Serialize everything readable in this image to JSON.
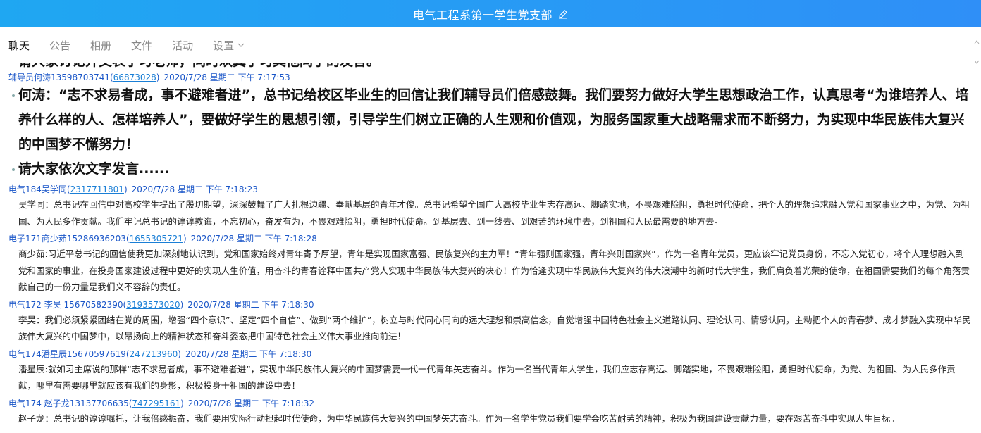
{
  "window": {
    "title": "电气工程系第一学生党支部"
  },
  "tabs": [
    {
      "label": "聊天"
    },
    {
      "label": "公告"
    },
    {
      "label": "相册"
    },
    {
      "label": "文件"
    },
    {
      "label": "活动"
    },
    {
      "label": "设置"
    }
  ],
  "chat": {
    "partial_top": "请大家讨论并交表了习老师，同时欢翼学习其他同学的发言。",
    "messages": [
      {
        "sender": "辅导员何涛13598703741",
        "qq": "66873028",
        "time": "2020/7/28 星期二 下午 7:17:53",
        "lines": [
          "何涛：“志不求易者成，事不避难者进”，总书记给校区毕业生的回信让我们辅导员们倍感鼓舞。我们要努力做好大学生思想政治工作，认真思考“为谁培养人、培养什么样的人、怎样培养人”，要做好学生的思想引领，引导学生们树立正确的人生观和价值观，为服务国家重大战略需求而不断努力，为实现中华民族伟大复兴的中国梦不懈努力！",
          "请大家依次文字发言......"
        ]
      },
      {
        "sender": "电气184吴学同",
        "qq": "2317711801",
        "time": "2020/7/28 星期二 下午 7:18:23",
        "text": "吴学同：总书记在回信中对高校学生提出了殷切期望，深深鼓舞了广大扎根边疆、奉献基层的青年才俊。总书记希望全国广大高校毕业生志存高远、脚踏实地，不畏艰难险阻，勇担时代使命，把个人的理想追求融入党和国家事业之中，为党、为祖国、为人民多作贡献。我们牢记总书记的谆谆教诲，不忘初心，奋发有为，不畏艰难险阻，勇担时代使命。到基层去、到一线去、到艰苦的环境中去，到祖国和人民最需要的地方去。"
      },
      {
        "sender": "电子171商少茹15286936203",
        "qq": "1655305721",
        "time": "2020/7/28 星期二 下午 7:18:28",
        "text": "商少茹:习近平总书记的回信使我更加深刻地认识到，党和国家始终对青年寄予厚望，青年是实现国家富强、民族复兴的主力军！“青年强则国家强，青年兴则国家兴”，作为一名青年党员，更应该牢记党员身份，不忘入党初心，将个人理想融入到党和国家的事业，在投身国家建设过程中更好的实现人生价值，用奋斗的青春诠释中国共产党人实现中华民族伟大复兴的决心！作为恰逢实现中华民族伟大复兴的伟大浪潮中的新时代大学生，我们肩负着光荣的使命，在祖国需要我们的每个角落贡献自己的一份力量是我们义不容辞的责任。"
      },
      {
        "sender": "电气172 李昊 15670582390",
        "qq": "3193573020",
        "time": "2020/7/28 星期二 下午 7:18:30",
        "text": "李昊：我们必须紧紧团结在党的周围，增强“四个意识”、坚定“四个自信”、做到“两个维护”，树立与时代同心同向的远大理想和崇高信念，自觉增强中国特色社会主义道路认同、理论认同、情感认同，主动把个人的青春梦、成才梦融入实现中华民族伟大复兴的中国梦中，以昂扬向上的精神状态和奋斗姿态把中国特色社会主义伟大事业推向前进！"
      },
      {
        "sender": "电气174潘星辰15670597619",
        "qq": "247213960",
        "time": "2020/7/28 星期二 下午 7:18:30",
        "text": "潘星辰:就如习主席说的那样“志不求易者成，事不避难者进”，实现中华民族伟大复兴的中国梦需要一代一代青年矢志奋斗。作为一名当代青年大学生，我们应志存高远、脚踏实地，不畏艰难险阻，勇担时代使命，为党、为祖国、为人民多作贡献，哪里有需要哪里就应该有我们的身影，积极投身于祖国的建设中去！"
      },
      {
        "sender": "电气174 赵子龙13137706635",
        "qq": "747295161",
        "time": "2020/7/28 星期二 下午 7:18:32",
        "text": "赵子龙：总书记的谆谆嘱托，让我倍感振奋，我们要用实际行动担起时代使命，为中华民族伟大复兴的中国梦矢志奋斗。作为一名学生党员我们要学会吃苦耐劳的精神，积极为我国建设贡献力量，要在艰苦奋斗中实现人生目标。"
      }
    ]
  }
}
